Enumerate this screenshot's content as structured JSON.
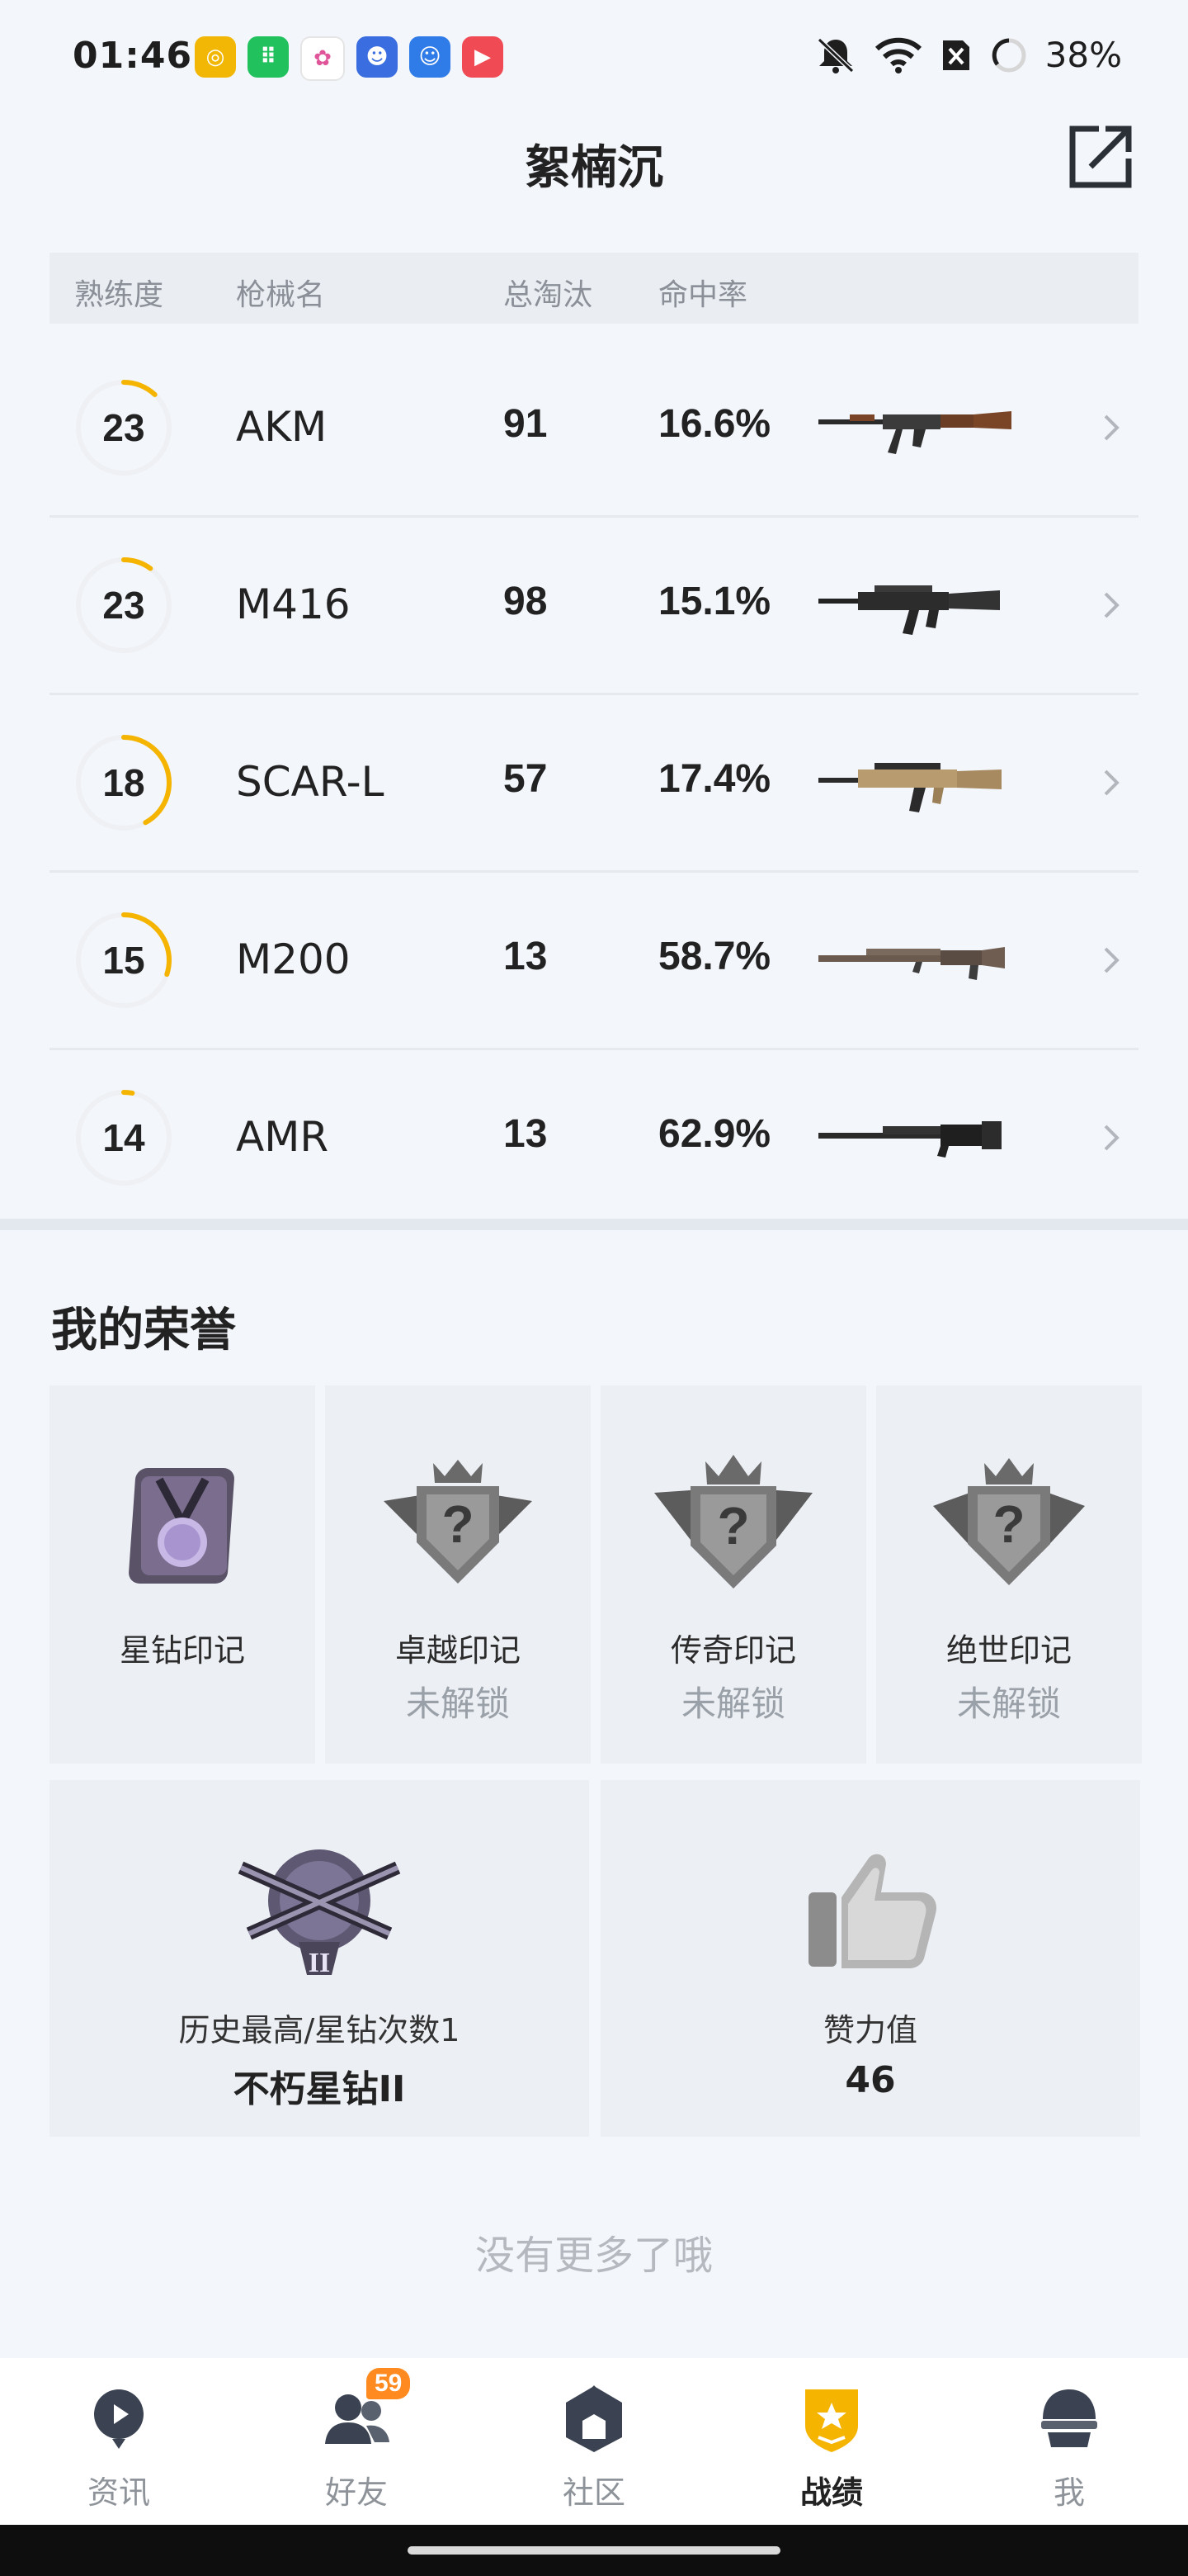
{
  "status_bar": {
    "time": "01:46",
    "battery": "38%",
    "icons": [
      "mute-icon",
      "wifi-icon",
      "sim-off-icon",
      "battery-icon"
    ],
    "apps": [
      {
        "name": "app-icon-1",
        "color": "#f2b705"
      },
      {
        "name": "app-icon-2",
        "color": "#21c25e"
      },
      {
        "name": "app-icon-3",
        "color": "#ffffff"
      },
      {
        "name": "app-icon-4",
        "color": "#3a6de0"
      },
      {
        "name": "app-icon-5",
        "color": "#2f7be8"
      },
      {
        "name": "app-icon-6",
        "color": "#f04a55"
      }
    ]
  },
  "header": {
    "title": "絮楠沉",
    "share_icon": "share-icon"
  },
  "table": {
    "columns": [
      "熟练度",
      "枪械名",
      "总淘汰",
      "命中率"
    ],
    "rows": [
      {
        "level": "23",
        "progress": 0.12,
        "name": "AKM",
        "kills": "91",
        "accuracy": "16.6%",
        "gun": "akm-rifle-icon"
      },
      {
        "level": "23",
        "progress": 0.1,
        "name": "M416",
        "kills": "98",
        "accuracy": "15.1%",
        "gun": "m416-rifle-icon"
      },
      {
        "level": "18",
        "progress": 0.42,
        "name": "SCAR-L",
        "kills": "57",
        "accuracy": "17.4%",
        "gun": "scar-l-rifle-icon"
      },
      {
        "level": "15",
        "progress": 0.3,
        "name": "M200",
        "kills": "13",
        "accuracy": "58.7%",
        "gun": "m200-sniper-icon"
      },
      {
        "level": "14",
        "progress": 0.03,
        "name": "AMR",
        "kills": "13",
        "accuracy": "62.9%",
        "gun": "amr-sniper-icon"
      }
    ]
  },
  "honor": {
    "title": "我的荣誉",
    "badges": [
      {
        "name": "星钻印记",
        "status": "",
        "icon": "star-diamond-medal-icon"
      },
      {
        "name": "卓越印记",
        "status": "未解锁",
        "icon": "locked-emblem-icon"
      },
      {
        "name": "传奇印记",
        "status": "未解锁",
        "icon": "locked-emblem-icon"
      },
      {
        "name": "绝世印记",
        "status": "未解锁",
        "icon": "locked-emblem-icon"
      }
    ],
    "highest": {
      "label": "历史最高/星钻次数1",
      "value": "不朽星钻II",
      "icon": "rank-crest-icon"
    },
    "likes": {
      "label": "赞力值",
      "value": "46",
      "icon": "thumbs-up-icon"
    }
  },
  "footer_text": "没有更多了哦",
  "bottom_nav": {
    "items": [
      {
        "label": "资讯",
        "icon": "news-icon",
        "active": false
      },
      {
        "label": "好友",
        "icon": "friends-icon",
        "active": false,
        "badge": "59"
      },
      {
        "label": "社区",
        "icon": "community-icon",
        "active": false
      },
      {
        "label": "战绩",
        "icon": "record-icon",
        "active": true
      },
      {
        "label": "我",
        "icon": "profile-icon",
        "active": false
      }
    ]
  },
  "colors": {
    "accent": "#f5b400",
    "ring_track": "#eef0f3",
    "badge": "#ff8a1f"
  }
}
